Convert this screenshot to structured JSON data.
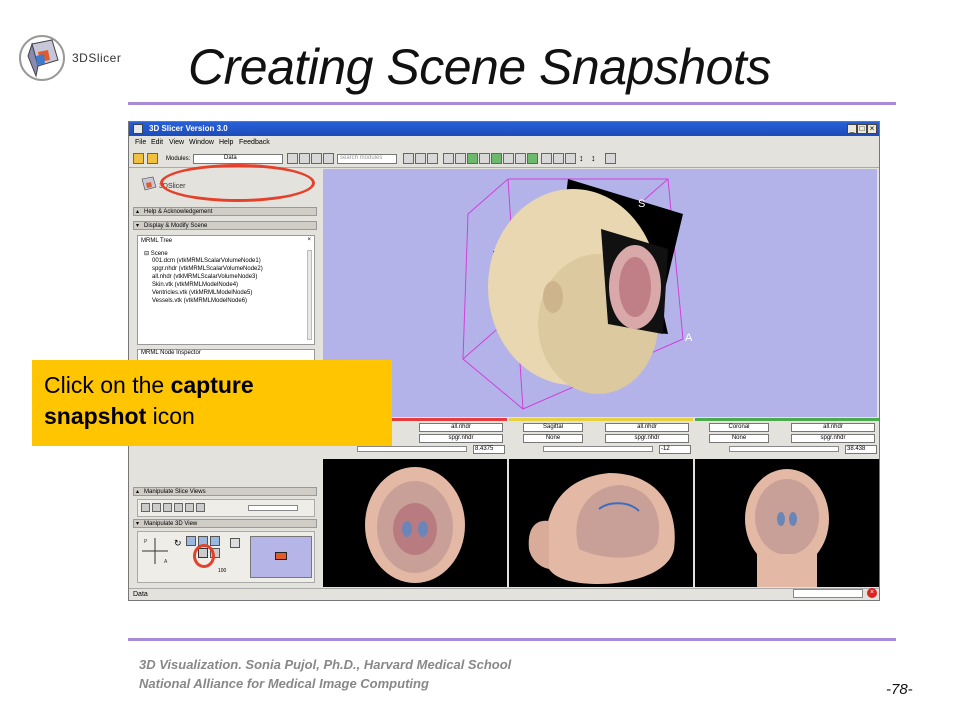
{
  "slide": {
    "logo_text": "3DSlicer",
    "title": "Creating Scene Snapshots",
    "footer_line1": "3D Visualization. Sonia Pujol, Ph.D., Harvard Medical School",
    "footer_line2": "National Alliance for Medical Image Computing",
    "page_number": "-78-",
    "accent_color": "#a88ad8"
  },
  "app": {
    "window_title": "3D Slicer Version 3.0",
    "window_buttons": [
      "_",
      "□",
      "×"
    ],
    "menu": [
      "File",
      "Edit",
      "View",
      "Window",
      "Help",
      "Feedback"
    ],
    "toolbar": {
      "modules_label": "Modules:",
      "modules_value": "Data",
      "search_placeholder": "search modules"
    },
    "left_panel": {
      "logo_text": "3DSlicer",
      "sections": [
        "Help & Acknowledgement",
        "Display & Modify Scene"
      ],
      "mrml_tree_label": "MRML Tree",
      "tree_items": [
        "Scene",
        "001.dcm (vtkMRMLScalarVolumeNode1)",
        "spgr.nhdr (vtkMRMLScalarVolumeNode2)",
        "all.nhdr (vtkMRMLScalarVolumeNode3)",
        "Skin.vtk (vtkMRMLModelNode4)",
        "Ventricles.vtk (vtkMRMLModelNode5)",
        "Vessels.vtk (vtkMRMLModelNode6)"
      ],
      "mrml_inspector_label": "MRML Node Inspector",
      "slice_views_section": "Manipulate Slice Views",
      "view3d_section": "Manipulate 3D View",
      "zoom_value": "100"
    },
    "view3d": {
      "orientation_labels": [
        "S",
        "A"
      ],
      "background_color": "#b3b3ea"
    },
    "slice_controllers": [
      {
        "name": "red",
        "color": "#e63c3c",
        "orientation": "",
        "fg": "all.nhdr",
        "bg": "spgr.nhdr",
        "value": "8.4375"
      },
      {
        "name": "yellow",
        "color": "#e6d23c",
        "orientation": "Sagittal",
        "label_sel": "None",
        "fg": "all.nhdr",
        "bg": "spgr.nhdr",
        "value": "-12"
      },
      {
        "name": "green",
        "color": "#4caa4c",
        "orientation": "Coronal",
        "label_sel": "None",
        "fg": "all.nhdr",
        "bg": "spgr.nhdr",
        "value": "38.438"
      }
    ],
    "status": {
      "text": "Data",
      "error_icon": "×"
    }
  },
  "callout": {
    "prefix": "Click on the ",
    "bold1": "capture",
    "bold2": "snapshot",
    "suffix": " icon",
    "color": "#ffc500"
  },
  "highlight_color": "#e5402a"
}
